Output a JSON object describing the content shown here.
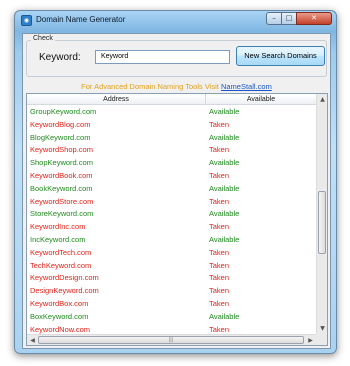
{
  "window": {
    "title": "Domain Name Generator",
    "icon": "app-icon",
    "controls": {
      "minimize": "–",
      "maximize": "□",
      "close": "✕"
    }
  },
  "check": {
    "legend": "Check",
    "keyword_label": "Keyword:",
    "keyword_value": "Keyword",
    "search_button": "New Search Domains"
  },
  "promo": {
    "text": "For Advanced Domain Naming Tools Visit ",
    "link": "NameStall.com"
  },
  "table": {
    "columns": [
      "Address",
      "Available"
    ],
    "rows": [
      {
        "address": "GroupKeyword.com",
        "status": "Available"
      },
      {
        "address": "KeywordBlog.com",
        "status": "Taken"
      },
      {
        "address": "BlogKeyword.com",
        "status": "Available"
      },
      {
        "address": "KeywordShop.com",
        "status": "Taken"
      },
      {
        "address": "ShopKeyword.com",
        "status": "Available"
      },
      {
        "address": "KeywordBook.com",
        "status": "Taken"
      },
      {
        "address": "BookKeyword.com",
        "status": "Available"
      },
      {
        "address": "KeywordStore.com",
        "status": "Taken"
      },
      {
        "address": "StoreKeyword.com",
        "status": "Available"
      },
      {
        "address": "KeywordInc.com",
        "status": "Taken"
      },
      {
        "address": "IncKeyword.com",
        "status": "Available"
      },
      {
        "address": "KeywordTech.com",
        "status": "Taken"
      },
      {
        "address": "TechKeyword.com",
        "status": "Taken"
      },
      {
        "address": "KeywordDesign.com",
        "status": "Taken"
      },
      {
        "address": "DesignKeyword.com",
        "status": "Taken"
      },
      {
        "address": "KeywordBox.com",
        "status": "Taken"
      },
      {
        "address": "BoxKeyword.com",
        "status": "Available"
      },
      {
        "address": "KeywordNow.com",
        "status": "Taken"
      }
    ]
  },
  "colors": {
    "available": "#1f8a1f",
    "taken": "#e2231a",
    "promo": "#e0a31f",
    "link": "#1a56c9"
  },
  "scrollbars": {
    "up": "▲",
    "down": "▼",
    "left": "◀",
    "right": "▶",
    "grip": "|||"
  }
}
